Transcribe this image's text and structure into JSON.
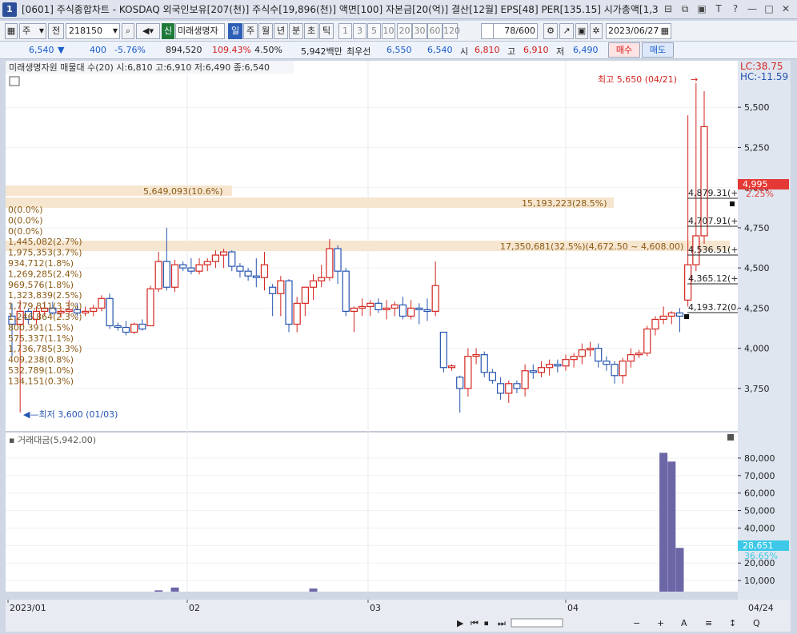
{
  "window": {
    "number": "1",
    "title": "[0601] 주식종합차트 - KOSDAQ 외국인보유[207(천)] 주식수[19,896(천)] 액면[100] 자본금[20(억)] 결산[12월] EPS[48] PER[135.15] 시가총액[1,3",
    "controls": [
      "⊟",
      "⧉",
      "▣",
      "T",
      "?",
      "—",
      "□",
      "✕"
    ]
  },
  "toolbar": {
    "period_main": "주",
    "jeon": "전",
    "code": "218150",
    "stock_name": "미래생명자",
    "badge": "신",
    "period_tabs": [
      "일",
      "주",
      "월",
      "년",
      "분",
      "초",
      "틱"
    ],
    "active_period": "일",
    "minute_options": [
      "1",
      "3",
      "5",
      "10",
      "20",
      "30",
      "60",
      "120"
    ],
    "count_value": "78",
    "count_total": "/600",
    "date": "2023/06/27"
  },
  "quote": {
    "price": "6,540",
    "change": "400",
    "change_pct": "-5.76%",
    "volume": "894,520",
    "volume_ratio": "109.43%",
    "turnover": "4.50%",
    "amount": "5,942백만",
    "best_ask_label": "최우선",
    "best_ask": "6,550",
    "best_bid": "6,540",
    "open_label": "시",
    "open": "6,810",
    "high_label": "고",
    "high": "6,910",
    "low_label": "저",
    "low": "6,490",
    "buy_label": "매수",
    "sell_label": "매도"
  },
  "main_chart": {
    "header": "미래생명자원 매물대 수(20)  시:6,810 고:6,910 저:6,490 종:6,540",
    "max_label": "최고 5,650 (04/21)",
    "min_label": "최저 3,600 (01/03)",
    "lc_label": "LC:38.75",
    "hc_label": "HC:-11.59",
    "current_price_tag": "4,995",
    "current_pct_tag": "2.25%",
    "price_ticks": [
      "5,500",
      "5,250",
      "5,000",
      "4,750",
      "4,500",
      "4,250",
      "4,000",
      "3,750"
    ],
    "volume_profile": [
      "5,649,093(10.6%)",
      "15,193,223(28.5%)",
      "0(0.0%)",
      "0(0.0%)",
      "0(0.0%)",
      "17,350,681(32.5%)(4,672.50 ~ 4,608.00)",
      "1,445,082(2.7%)",
      "1,975,353(3.7%)",
      "934,712(1.8%)",
      "1,269,285(2.4%)",
      "969,576(1.8%)",
      "1,323,839(2.5%)",
      "1,779,811(3.3%)",
      "1,246,864(2.3%)",
      "800,391(1.5%)",
      "575,337(1.1%)",
      "1,736,785(3.3%)",
      "409,238(0.8%)",
      "532,789(1.0%)",
      "134,151(0.3%)"
    ],
    "level_labels": [
      "4,879.31(+",
      "4,707.91(+",
      "4,536.51(+",
      "4,365.12(+",
      "4,193.72(0."
    ]
  },
  "volume_chart": {
    "header": "거래대금(5,942.00)",
    "ticks": [
      "80,000",
      "70,000",
      "60,000",
      "50,000",
      "40,000",
      "30,000",
      "20,000",
      "10,000"
    ],
    "current_tag": "28,651",
    "current_pct_tag": "36.65%"
  },
  "x_axis": {
    "labels": [
      "2023/01",
      "02",
      "03",
      "04"
    ],
    "end_label": "04/24"
  },
  "chart_data": {
    "type": "candlestick",
    "price_ylim": [
      3600,
      5700
    ],
    "volume_ylim": [
      0,
      85000
    ],
    "candles": [
      [
        4200,
        4280,
        3950,
        4150
      ],
      [
        4150,
        4300,
        3600,
        4230
      ],
      [
        4230,
        4250,
        4150,
        4180
      ],
      [
        4180,
        4260,
        4150,
        4230
      ],
      [
        4230,
        4290,
        4200,
        4250
      ],
      [
        4250,
        4290,
        4210,
        4220
      ],
      [
        4220,
        4260,
        4190,
        4230
      ],
      [
        4230,
        4300,
        4200,
        4240
      ],
      [
        4240,
        4280,
        4200,
        4220
      ],
      [
        4220,
        4260,
        4200,
        4230
      ],
      [
        4230,
        4270,
        4200,
        4250
      ],
      [
        4250,
        4330,
        4230,
        4310
      ],
      [
        4310,
        4340,
        4120,
        4140
      ],
      [
        4140,
        4160,
        4110,
        4130
      ],
      [
        4130,
        4170,
        4080,
        4100
      ],
      [
        4100,
        4160,
        4090,
        4150
      ],
      [
        4150,
        4180,
        4110,
        4120
      ],
      [
        4140,
        4390,
        4140,
        4370
      ],
      [
        4370,
        4600,
        4350,
        4540
      ],
      [
        4540,
        4750,
        4360,
        4380
      ],
      [
        4380,
        4550,
        4350,
        4520
      ],
      [
        4520,
        4540,
        4480,
        4500
      ],
      [
        4500,
        4560,
        4460,
        4480
      ],
      [
        4480,
        4560,
        4460,
        4520
      ],
      [
        4520,
        4560,
        4480,
        4540
      ],
      [
        4540,
        4610,
        4500,
        4580
      ],
      [
        4580,
        4620,
        4500,
        4600
      ],
      [
        4600,
        4610,
        4480,
        4510
      ],
      [
        4510,
        4530,
        4440,
        4480
      ],
      [
        4480,
        4500,
        4420,
        4450
      ],
      [
        4450,
        4560,
        4380,
        4440
      ],
      [
        4440,
        4600,
        4360,
        4520
      ],
      [
        4380,
        4400,
        4200,
        4340
      ],
      [
        4340,
        4450,
        4200,
        4420
      ],
      [
        4420,
        4430,
        4100,
        4150
      ],
      [
        4150,
        4320,
        4100,
        4280
      ],
      [
        4280,
        4360,
        4200,
        4380
      ],
      [
        4380,
        4460,
        4300,
        4420
      ],
      [
        4420,
        4520,
        4380,
        4440
      ],
      [
        4440,
        4680,
        4420,
        4620
      ],
      [
        4620,
        4640,
        4400,
        4480
      ],
      [
        4480,
        4500,
        4200,
        4230
      ],
      [
        4230,
        4260,
        4100,
        4250
      ],
      [
        4250,
        4310,
        4200,
        4260
      ],
      [
        4260,
        4300,
        4200,
        4280
      ],
      [
        4280,
        4310,
        4220,
        4240
      ],
      [
        4240,
        4300,
        4180,
        4250
      ],
      [
        4250,
        4290,
        4200,
        4270
      ],
      [
        4270,
        4320,
        4180,
        4200
      ],
      [
        4200,
        4300,
        4180,
        4250
      ],
      [
        4250,
        4280,
        4150,
        4240
      ],
      [
        4240,
        4310,
        4170,
        4230
      ],
      [
        4230,
        4540,
        4200,
        4390
      ],
      [
        4100,
        4100,
        3850,
        3880
      ],
      [
        3880,
        3900,
        3860,
        3890
      ],
      [
        3820,
        3830,
        3600,
        3750
      ],
      [
        3750,
        4000,
        3700,
        3950
      ],
      [
        3950,
        4000,
        3900,
        3960
      ],
      [
        3960,
        3980,
        3820,
        3850
      ],
      [
        3850,
        3870,
        3780,
        3800
      ],
      [
        3780,
        3820,
        3680,
        3720
      ],
      [
        3720,
        3800,
        3660,
        3780
      ],
      [
        3780,
        3800,
        3720,
        3750
      ],
      [
        3750,
        3900,
        3700,
        3860
      ],
      [
        3860,
        3900,
        3810,
        3850
      ],
      [
        3850,
        3920,
        3820,
        3880
      ],
      [
        3880,
        3930,
        3830,
        3900
      ],
      [
        3900,
        3930,
        3850,
        3890
      ],
      [
        3890,
        3960,
        3860,
        3930
      ],
      [
        3930,
        3970,
        3880,
        3950
      ],
      [
        3950,
        4030,
        3900,
        3990
      ],
      [
        3990,
        4040,
        3950,
        4000
      ],
      [
        4000,
        4030,
        3880,
        3920
      ],
      [
        3920,
        3950,
        3860,
        3900
      ],
      [
        3900,
        3920,
        3780,
        3830
      ],
      [
        3830,
        3940,
        3780,
        3920
      ],
      [
        3920,
        4000,
        3880,
        3960
      ],
      [
        3960,
        3990,
        3940,
        3970
      ],
      [
        3970,
        4140,
        3950,
        4120
      ],
      [
        4120,
        4200,
        4080,
        4180
      ],
      [
        4180,
        4260,
        4150,
        4200
      ],
      [
        4200,
        4230,
        4150,
        4220
      ],
      [
        4220,
        4250,
        4100,
        4200
      ],
      [
        4300,
        5450,
        4260,
        4520
      ],
      [
        4520,
        5650,
        4480,
        4700
      ],
      [
        4700,
        5600,
        4650,
        5380
      ]
    ],
    "volumes": [
      2000,
      2800,
      1700,
      1600,
      3200,
      1500,
      1500,
      1400,
      1500,
      1600,
      1500,
      1700,
      1600,
      1500,
      1500,
      1600,
      1500,
      2000,
      4400,
      3400,
      6000,
      1400,
      1600,
      1700,
      1500,
      1600,
      1400,
      1500,
      1600,
      1400,
      1500,
      2200,
      1500,
      2800,
      1400,
      1500,
      1600,
      5400,
      1700,
      1400,
      1500,
      1400,
      1500,
      1400,
      1500,
      1400,
      1600,
      1400,
      1500,
      1400,
      1500,
      1400,
      1500,
      2900,
      1900,
      1600,
      1500,
      1400,
      1500,
      1400,
      1300,
      1400,
      1500,
      1400,
      1300,
      1400,
      1300,
      1400,
      1300,
      1400,
      1300,
      1400,
      1500,
      1400,
      1300,
      1400,
      1300,
      1400,
      1500,
      1400,
      83000,
      78000,
      28651
    ]
  },
  "scrollbar": {
    "icons": [
      "▶",
      "⏮",
      "⏹",
      "⏭",
      "−",
      "+",
      "A",
      "≡",
      "↕",
      "Q"
    ]
  }
}
